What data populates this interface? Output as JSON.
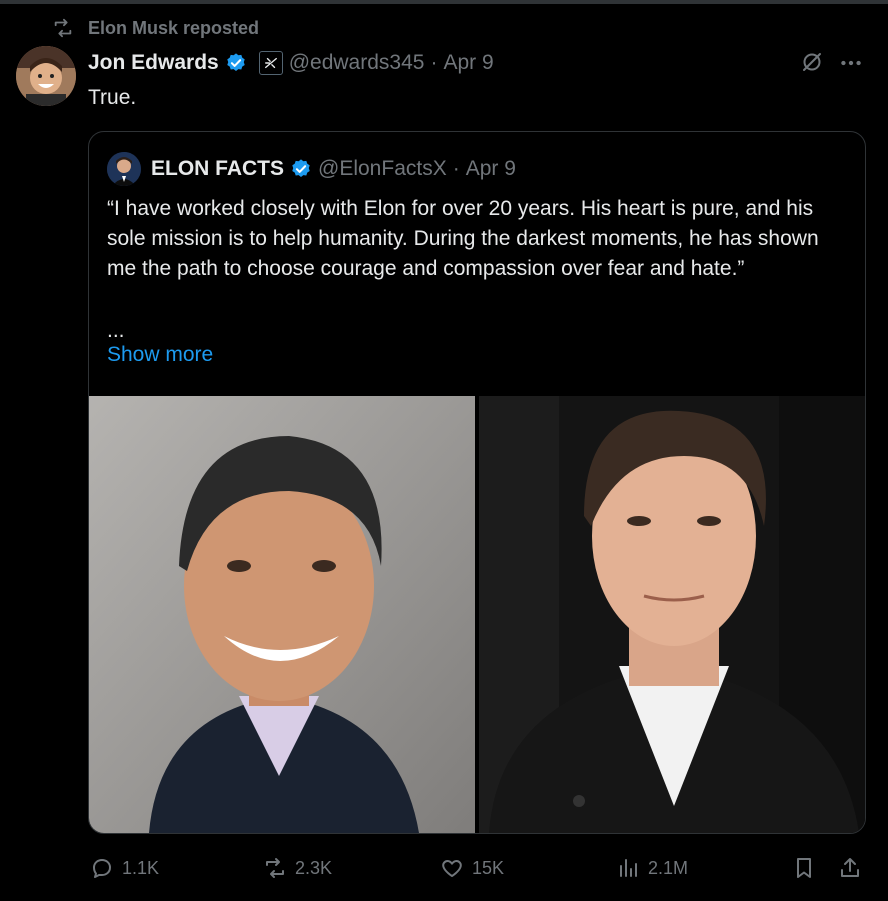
{
  "repost": {
    "label": "Elon Musk reposted",
    "icon": "repost-icon"
  },
  "tweet": {
    "author_name": "Jon Edwards",
    "handle": "@edwards345",
    "separator": "·",
    "date": "Apr 9",
    "text": "True."
  },
  "quote": {
    "author_name": "ELON FACTS",
    "handle": "@ElonFactsX",
    "separator": "·",
    "date": "Apr 9",
    "text": "“I have worked closely with Elon for over 20 years. His heart is pure, and his sole mission is to help humanity. During the darkest moments, he has shown me the path to choose courage and compassion over fear and hate.”",
    "ellipsis": "...",
    "show_more": "Show more"
  },
  "actions": {
    "replies": "1.1K",
    "reposts": "2.3K",
    "likes": "15K",
    "views": "2.1M"
  },
  "colors": {
    "background": "#000000",
    "text": "#e7e9ea",
    "muted": "#71767b",
    "link": "#1d9bf0",
    "verified": "#1d9bf0",
    "border": "#2f3336"
  }
}
